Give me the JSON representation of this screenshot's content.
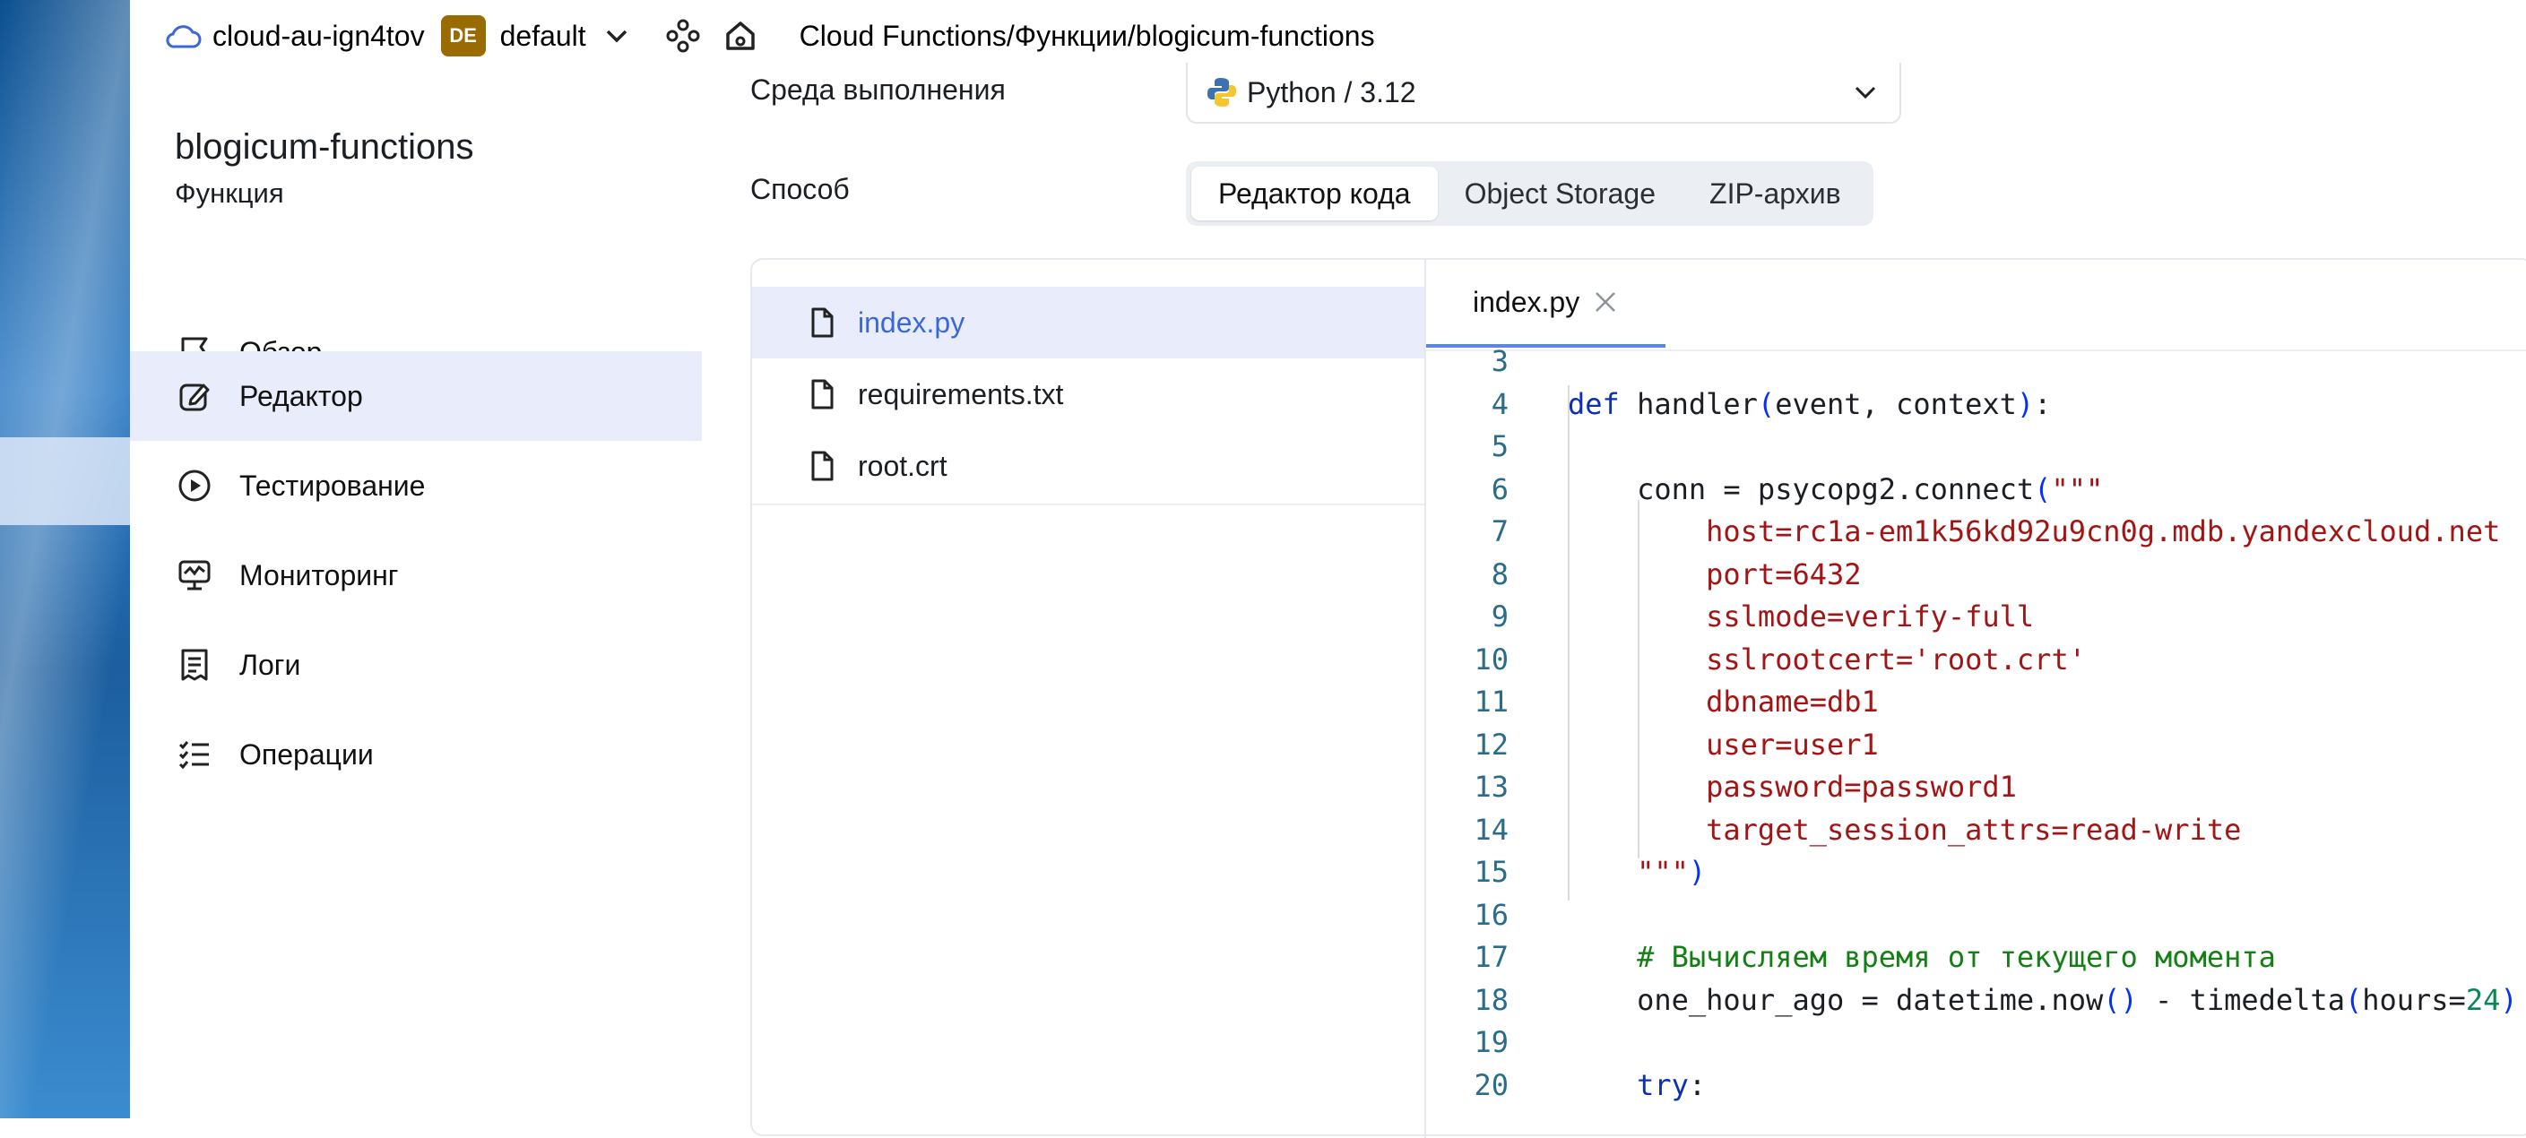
{
  "header": {
    "cloud": "cloud-au-ign4tov",
    "badge": "DE",
    "folder": "default",
    "crumbs": [
      "Cloud Functions",
      "Функции",
      "blogicum-functions"
    ]
  },
  "sidebar": {
    "title": "blogicum-functions",
    "subtitle": "Функция",
    "items": [
      {
        "label": "Обзор",
        "icon": "flag-icon"
      },
      {
        "label": "Редактор",
        "icon": "edit-icon",
        "active": true
      },
      {
        "label": "Тестирование",
        "icon": "play-circle-icon"
      },
      {
        "label": "Мониторинг",
        "icon": "monitor-icon"
      },
      {
        "label": "Логи",
        "icon": "logs-icon"
      },
      {
        "label": "Операции",
        "icon": "operations-icon"
      }
    ]
  },
  "form": {
    "runtime_label": "Среда выполнения",
    "runtime_value": "Python / 3.12",
    "method_label": "Способ",
    "method_options": [
      "Редактор кода",
      "Object Storage",
      "ZIP-архив"
    ],
    "method_selected": "Редактор кода"
  },
  "files": [
    "index.py",
    "requirements.txt",
    "root.crt"
  ],
  "active_file": "index.py",
  "editor": {
    "tab": "index.py",
    "lines": [
      {
        "n": "3",
        "code": ""
      },
      {
        "n": "4",
        "code": "def handler(event, context):"
      },
      {
        "n": "5",
        "code": ""
      },
      {
        "n": "6",
        "code": "    conn = psycopg2.connect(\"\"\""
      },
      {
        "n": "7",
        "code": "        host=rc1a-em1k56kd92u9cn0g.mdb.yandexcloud.net"
      },
      {
        "n": "8",
        "code": "        port=6432"
      },
      {
        "n": "9",
        "code": "        sslmode=verify-full"
      },
      {
        "n": "10",
        "code": "        sslrootcert='root.crt'"
      },
      {
        "n": "11",
        "code": "        dbname=db1"
      },
      {
        "n": "12",
        "code": "        user=user1"
      },
      {
        "n": "13",
        "code": "        password=password1"
      },
      {
        "n": "14",
        "code": "        target_session_attrs=read-write"
      },
      {
        "n": "15",
        "code": "    \"\"\")"
      },
      {
        "n": "16",
        "code": ""
      },
      {
        "n": "17",
        "code": "    # Вычисляем время от текущего момента"
      },
      {
        "n": "18",
        "code": "    one_hour_ago = datetime.now() - timedelta(hours=24)"
      },
      {
        "n": "19",
        "code": ""
      },
      {
        "n": "20",
        "code": "    try:"
      }
    ]
  },
  "colors": {
    "accent": "#5c86e0",
    "active_bg": "#e8ecfb",
    "badge": "#9a6b00"
  }
}
